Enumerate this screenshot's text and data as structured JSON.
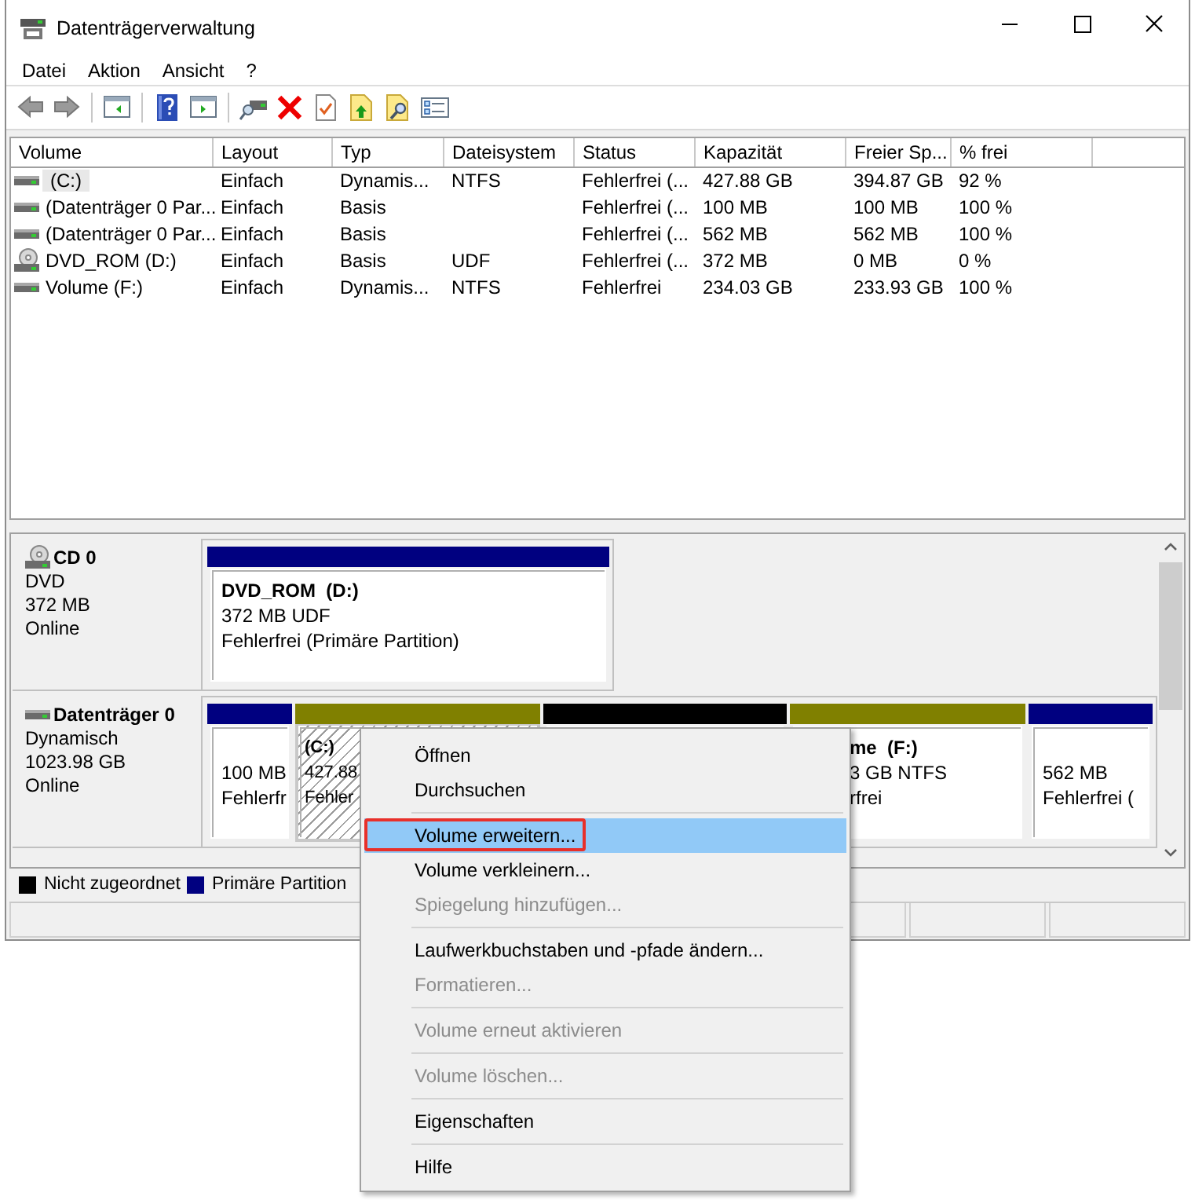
{
  "window": {
    "title": "Datenträgerverwaltung"
  },
  "menu": [
    "Datei",
    "Aktion",
    "Ansicht",
    "?"
  ],
  "toolbar": [
    {
      "kind": "back"
    },
    {
      "kind": "forward"
    },
    {
      "kind": "sep"
    },
    {
      "kind": "tree"
    },
    {
      "kind": "sep"
    },
    {
      "kind": "help"
    },
    {
      "kind": "pane"
    },
    {
      "kind": "sep"
    },
    {
      "kind": "connect"
    },
    {
      "kind": "delete"
    },
    {
      "kind": "properties"
    },
    {
      "kind": "folder-up"
    },
    {
      "kind": "folder-search"
    },
    {
      "kind": "checklist"
    }
  ],
  "volume_table": {
    "columns": [
      "Volume",
      "Layout",
      "Typ",
      "Dateisystem",
      "Status",
      "Kapazität",
      "Freier Sp...",
      "% frei"
    ],
    "rows": [
      {
        "kind": "disk",
        "selected": true,
        "cells": [
          "(C:)",
          "Einfach",
          "Dynamis...",
          "NTFS",
          "Fehlerfrei (...",
          "427.88 GB",
          "394.87 GB",
          "92 %"
        ]
      },
      {
        "kind": "disk",
        "selected": false,
        "cells": [
          "(Datenträger 0 Par...",
          "Einfach",
          "Basis",
          "",
          "Fehlerfrei (...",
          "100 MB",
          "100 MB",
          "100 %"
        ]
      },
      {
        "kind": "disk",
        "selected": false,
        "cells": [
          "(Datenträger 0 Par...",
          "Einfach",
          "Basis",
          "",
          "Fehlerfrei (...",
          "562 MB",
          "562 MB",
          "100 %"
        ]
      },
      {
        "kind": "cd",
        "selected": false,
        "cells": [
          "DVD_ROM (D:)",
          "Einfach",
          "Basis",
          "UDF",
          "Fehlerfrei (...",
          "372 MB",
          "0 MB",
          "0 %"
        ]
      },
      {
        "kind": "disk",
        "selected": false,
        "cells": [
          "Volume (F:)",
          "Einfach",
          "Dynamis...",
          "NTFS",
          "Fehlerfrei",
          "234.03 GB",
          "233.93 GB",
          "100 %"
        ]
      }
    ]
  },
  "disks": [
    {
      "kind": "cd",
      "name": "CD 0",
      "type": "DVD",
      "size": "372 MB",
      "status": "Online",
      "partitions": [
        {
          "color": "#000080",
          "selected": false,
          "name": "DVD_ROM  (D:)",
          "lines": [
            "372 MB UDF",
            "Fehlerfrei (Primäre Partition)"
          ]
        }
      ]
    },
    {
      "kind": "disk",
      "name": "Datenträger 0",
      "type": "Dynamisch",
      "size": "1023.98 GB",
      "status": "Online",
      "partitions": [
        {
          "color": "#000080",
          "selected": false,
          "lines": [
            "100 MB",
            "Fehlerfr"
          ]
        },
        {
          "color": "#808000",
          "selected": true,
          "name": "(C:)",
          "lines": [
            "427.88",
            "Fehler"
          ]
        },
        {
          "color": "#000000",
          "selected": false
        },
        {
          "color": "#808000",
          "selected": false,
          "name": "me  (F:)",
          "lines": [
            "3 GB NTFS",
            "rfrei"
          ]
        },
        {
          "color": "#000080",
          "selected": false,
          "lines": [
            "562 MB",
            "Fehlerfrei ("
          ]
        }
      ]
    }
  ],
  "legend": [
    {
      "label": "Nicht zugeordnet",
      "color": "#000000"
    },
    {
      "label": "Primäre Partition",
      "color": "#000080"
    }
  ],
  "context_menu": [
    {
      "kind": "item",
      "label": "Öffnen",
      "disabled": false,
      "selected": false,
      "outlined": false
    },
    {
      "kind": "item",
      "label": "Durchsuchen",
      "disabled": false,
      "selected": false,
      "outlined": false
    },
    {
      "kind": "separator"
    },
    {
      "kind": "item",
      "label": "Volume erweitern...",
      "disabled": false,
      "selected": true,
      "outlined": true
    },
    {
      "kind": "item",
      "label": "Volume verkleinern...",
      "disabled": false,
      "selected": false,
      "outlined": false
    },
    {
      "kind": "item",
      "label": "Spiegelung hinzufügen...",
      "disabled": true,
      "selected": false,
      "outlined": false
    },
    {
      "kind": "separator"
    },
    {
      "kind": "item",
      "label": "Laufwerkbuchstaben und -pfade ändern...",
      "disabled": false,
      "selected": false,
      "outlined": false
    },
    {
      "kind": "item",
      "label": "Formatieren...",
      "disabled": true,
      "selected": false,
      "outlined": false
    },
    {
      "kind": "separator"
    },
    {
      "kind": "item",
      "label": "Volume erneut aktivieren",
      "disabled": true,
      "selected": false,
      "outlined": false
    },
    {
      "kind": "separator"
    },
    {
      "kind": "item",
      "label": "Volume löschen...",
      "disabled": true,
      "selected": false,
      "outlined": false
    },
    {
      "kind": "separator"
    },
    {
      "kind": "item",
      "label": "Eigenschaften",
      "disabled": false,
      "selected": false,
      "outlined": false
    },
    {
      "kind": "separator"
    },
    {
      "kind": "item",
      "label": "Hilfe",
      "disabled": false,
      "selected": false,
      "outlined": false
    }
  ]
}
